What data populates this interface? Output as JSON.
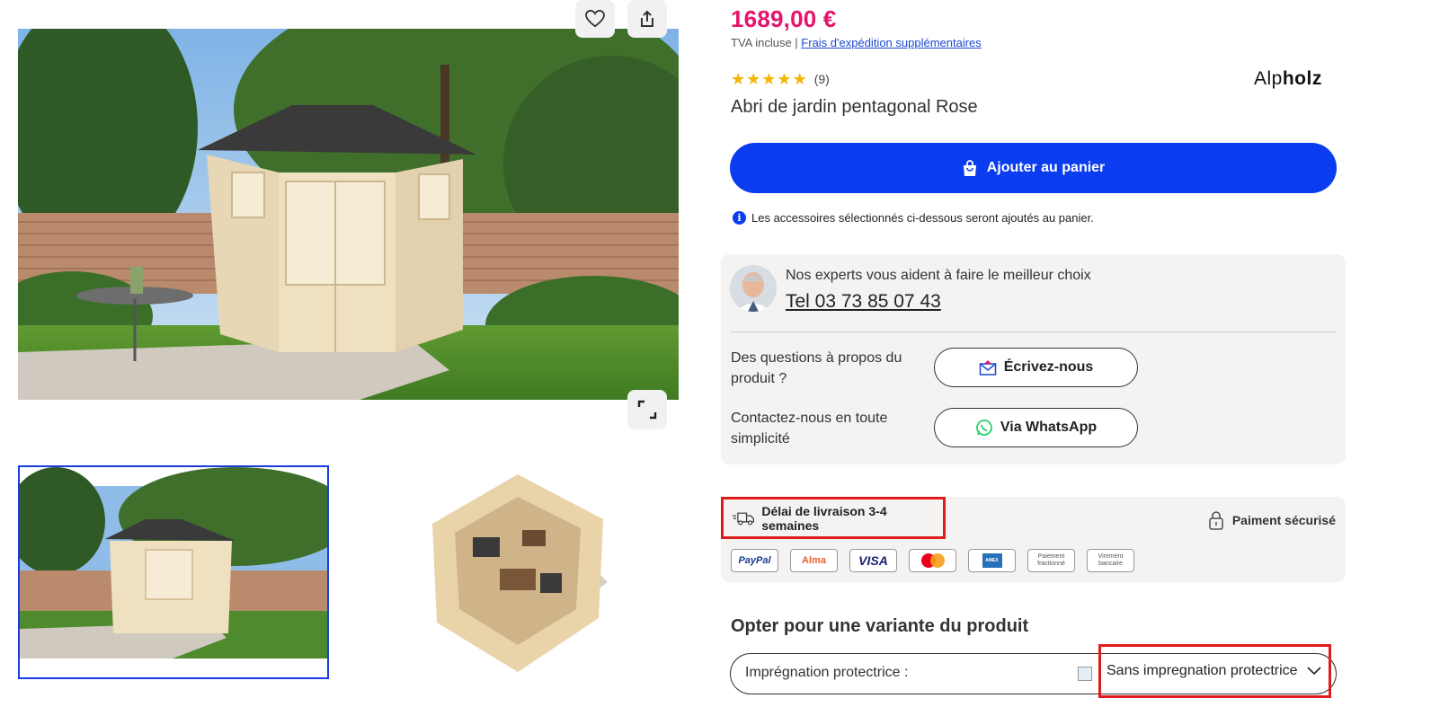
{
  "gallery": {
    "favorite_icon": "heart-icon",
    "share_icon": "share-icon",
    "expand_icon": "expand-icon"
  },
  "product": {
    "price": "1689,00 €",
    "vat_text": "TVA incluse |",
    "shipping_link": "Frais d'expédition supplémentaires",
    "rating_stars": 5,
    "review_count": "(9)",
    "brand_light": "Alp",
    "brand_bold": "holz",
    "title": "Abri de jardin pentagonal Rose"
  },
  "cart": {
    "add_label": "Ajouter au panier",
    "info_text": "Les accessoires sélectionnés ci-dessous seront ajoutés au panier."
  },
  "experts": {
    "headline": "Nos experts vous aident à faire le meilleur choix",
    "phone": "Tel 03 73 85 07 43",
    "question_1": "Des questions à propos du produit ?",
    "button_1": "Écrivez-nous",
    "question_2": "Contactez-nous en toute simplicité",
    "button_2": "Via WhatsApp"
  },
  "delivery": {
    "delay": "Délai de livraison 3-4 semaines",
    "secure": "Paiment sécurisé",
    "payments": [
      {
        "label": "PayPal",
        "color": "#1a3a8f"
      },
      {
        "label": "Alma",
        "color": "#f05a28"
      },
      {
        "label": "VISA",
        "color": "#1a1f71"
      },
      {
        "label": "",
        "color": "#eb001b"
      },
      {
        "label": "AMEX",
        "color": "#2671b9"
      },
      {
        "label": "Paiement fractionné",
        "color": "#555555"
      },
      {
        "label": "Virement bancaire",
        "color": "#555555"
      }
    ]
  },
  "variant": {
    "title": "Opter pour une variante du produit",
    "field_label": "Imprégnation protectrice :",
    "selected": "Sans impregnation protectrice"
  },
  "colors": {
    "price": "#e8136b",
    "primary": "#0a3cf0",
    "highlight": "#e01b1b"
  }
}
